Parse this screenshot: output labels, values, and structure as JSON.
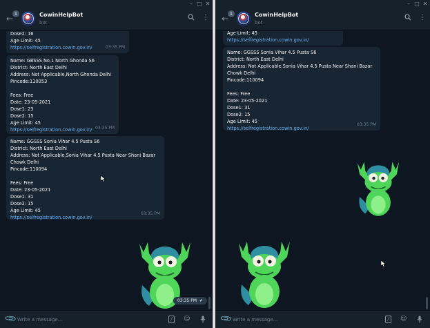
{
  "colors": {
    "chat_bg": "#0e1621",
    "header_bg": "#17212b",
    "bubble_bg": "#182533",
    "link": "#6ab3f3",
    "text": "#f5f5f5",
    "muted": "#6d7f8f",
    "sticker_green": "#4fd65a",
    "sticker_teal": "#2f8fa0"
  },
  "chat": {
    "name": "CowinHelpBot",
    "status": "bot",
    "unread_count": "1"
  },
  "input": {
    "placeholder": "Write a message..."
  },
  "left": {
    "messages": [
      {
        "lines": [
          "Dose2: 16",
          "Age Limit: 45",
          "https://selfregistration.cowin.gov.in/"
        ],
        "time": "03:35 PM"
      },
      {
        "lines": [
          "Name: GBSSS No.1 North Ghonda S6",
          "District: North East Delhi",
          "Address: Not Applicable,North Ghonda Delhi",
          "Pincode:110053",
          "",
          "Fees: Free",
          "Date: 23-05-2021",
          "Dose1: 23",
          "Dose2: 15",
          "Age Limit: 45",
          "https://selfregistration.cowin.gov.in/"
        ],
        "time": "03:35 PM"
      },
      {
        "lines": [
          "Name: GGSSS Sonia Vihar 4.5 Pusta S6",
          "District: North East Delhi",
          "Address: Not Applicable,Sonia Vihar 4.5 Pusta Near Shani Bazar",
          "Chowk Delhi",
          "Pincode:110094",
          "",
          "Fees: Free",
          "Date: 23-05-2021",
          "Dose1: 31",
          "Dose2: 15",
          "Age Limit: 45",
          "https://selfregistration.cowin.gov.in/"
        ],
        "time": "03:35 PM"
      }
    ],
    "sticker_time": "03:35 PM"
  },
  "right": {
    "messages": [
      {
        "lines": [
          "Age Limit: 45",
          "https://selfregistration.cowin.gov.in/"
        ],
        "time": "03:35 PM"
      },
      {
        "lines": [
          "Name: GGSSS Sonia Vihar 4.5 Pusta S6",
          "District: North East Delhi",
          "Address: Not Applicable,Sonia Vihar 4.5 Pusta Near Shani Bazar",
          "Chowk Delhi",
          "Pincode:110094",
          "",
          "Fees: Free",
          "Date: 23-05-2021",
          "Dose1: 31",
          "Dose2: 15",
          "Age Limit: 45",
          "https://selfregistration.cowin.gov.in/"
        ],
        "time": "03:35 PM"
      }
    ]
  },
  "icons": {
    "back": "back-arrow-icon",
    "search": "search-icon",
    "more": "more-vertical-icon",
    "attach": "paperclip-icon",
    "commands": "bot-commands-icon",
    "emoji": "emoji-icon",
    "mic": "microphone-icon",
    "read": "double-check-icon"
  }
}
